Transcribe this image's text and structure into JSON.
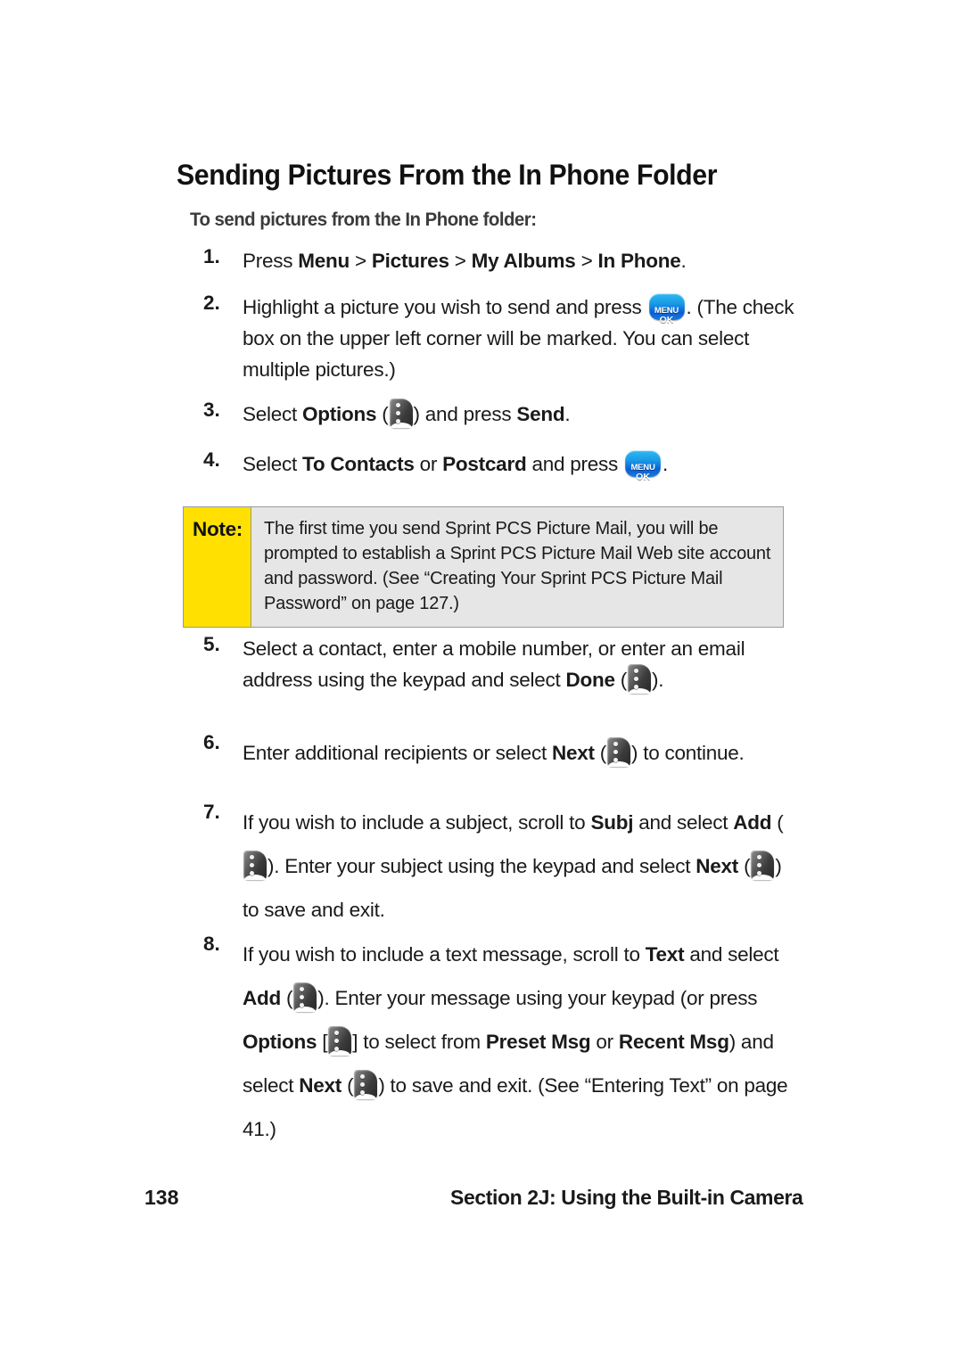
{
  "document": {
    "heading": "Sending Pictures From the In Phone Folder",
    "subheading": "To send pictures from the In Phone folder:"
  },
  "steps": [
    {
      "number": "1.",
      "parts": [
        {
          "t": "Press ",
          "b": false
        },
        {
          "t": "Menu",
          "b": true
        },
        {
          "t": " > ",
          "b": false
        },
        {
          "t": "Pictures",
          "b": true
        },
        {
          "t": " > ",
          "b": false
        },
        {
          "t": "My Albums",
          "b": true
        },
        {
          "t": " > ",
          "b": false
        },
        {
          "t": "In Phone",
          "b": true
        },
        {
          "t": ".",
          "b": false
        }
      ]
    },
    {
      "number": "2.",
      "parts": [
        {
          "t": "Highlight a picture you wish to send and press ",
          "b": false
        },
        {
          "icon": "menu-ok"
        },
        {
          "t": ". (The check box on the upper left corner will be marked. You can select multiple pictures.)",
          "b": false
        }
      ]
    },
    {
      "number": "3.",
      "parts": [
        {
          "t": "Select ",
          "b": false
        },
        {
          "t": "Options",
          "b": true
        },
        {
          "t": " (",
          "b": false
        },
        {
          "icon": "softkey"
        },
        {
          "t": ") and press ",
          "b": false
        },
        {
          "t": "Send",
          "b": true
        },
        {
          "t": ".",
          "b": false
        }
      ]
    },
    {
      "number": "4.",
      "parts": [
        {
          "t": "Select ",
          "b": false
        },
        {
          "t": "To Contacts",
          "b": true
        },
        {
          "t": " or ",
          "b": false
        },
        {
          "t": "Postcard",
          "b": true
        },
        {
          "t": " and press ",
          "b": false
        },
        {
          "icon": "menu-ok"
        },
        {
          "t": ".",
          "b": false
        }
      ]
    },
    {
      "number": "5.",
      "parts": [
        {
          "t": "Select a contact, enter a mobile number, or enter an email address using the keypad and select ",
          "b": false
        },
        {
          "t": "Done",
          "b": true
        },
        {
          "t": " (",
          "b": false
        },
        {
          "icon": "softkey"
        },
        {
          "t": ").",
          "b": false
        }
      ]
    },
    {
      "number": "6.",
      "parts": [
        {
          "t": "Enter additional recipients or select ",
          "b": false
        },
        {
          "t": "Next",
          "b": true
        },
        {
          "t": " (",
          "b": false
        },
        {
          "icon": "softkey"
        },
        {
          "t": ") to continue.",
          "b": false
        }
      ]
    },
    {
      "number": "7.",
      "parts": [
        {
          "t": "If you wish to include a subject, scroll to ",
          "b": false
        },
        {
          "t": "Subj",
          "b": true
        },
        {
          "t": " and select ",
          "b": false
        },
        {
          "t": "Add",
          "b": true
        },
        {
          "t": " (",
          "b": false
        },
        {
          "icon": "softkey"
        },
        {
          "t": "). Enter your subject using the keypad and select ",
          "b": false
        },
        {
          "t": "Next",
          "b": true
        },
        {
          "t": " (",
          "b": false
        },
        {
          "icon": "softkey"
        },
        {
          "t": ") to save and exit.",
          "b": false
        }
      ]
    },
    {
      "number": "8.",
      "parts": [
        {
          "t": "If you wish to include a text message, scroll to ",
          "b": false
        },
        {
          "t": "Text",
          "b": true
        },
        {
          "t": " and select ",
          "b": false
        },
        {
          "t": "Add",
          "b": true
        },
        {
          "t": " (",
          "b": false
        },
        {
          "icon": "softkey"
        },
        {
          "t": "). Enter your message using your keypad (or press ",
          "b": false
        },
        {
          "t": "Options",
          "b": true
        },
        {
          "t": " [",
          "b": false
        },
        {
          "icon": "softkey"
        },
        {
          "t": "] to select from ",
          "b": false
        },
        {
          "t": "Preset Msg",
          "b": true
        },
        {
          "t": " or ",
          "b": false
        },
        {
          "t": "Recent Msg",
          "b": true
        },
        {
          "t": ") and select ",
          "b": false
        },
        {
          "t": "Next",
          "b": true
        },
        {
          "t": " (",
          "b": false
        },
        {
          "icon": "softkey"
        },
        {
          "t": ") to save and exit. (See “Entering Text” on page 41.)",
          "b": false
        }
      ]
    }
  ],
  "note": {
    "label": "Note:",
    "text": "The first time you send Sprint PCS Picture Mail, you will be prompted to establish a Sprint PCS Picture Mail Web site account and password. (See “Creating Your Sprint PCS Picture Mail Password” on page 127.)"
  },
  "footer": {
    "page_number": "138",
    "section": "Section 2J: Using the Built-in Camera"
  },
  "icons": {
    "menu_ok_line1": "MENU",
    "menu_ok_line2": "OK",
    "menu_ok_color": "#0a7fe0",
    "softkey_color": "#3c3c3c"
  },
  "colors": {
    "page_background": "#ffffff",
    "note_label_background": "#ffe000",
    "note_body_background": "#e6e6e6",
    "note_border": "#9a9a9a",
    "text": "#1a1a1a"
  },
  "layout": {
    "step_tops": [
      275,
      327,
      447,
      503,
      710,
      820,
      898,
      1046
    ],
    "loose_steps": [
      5,
      6,
      7
    ]
  }
}
